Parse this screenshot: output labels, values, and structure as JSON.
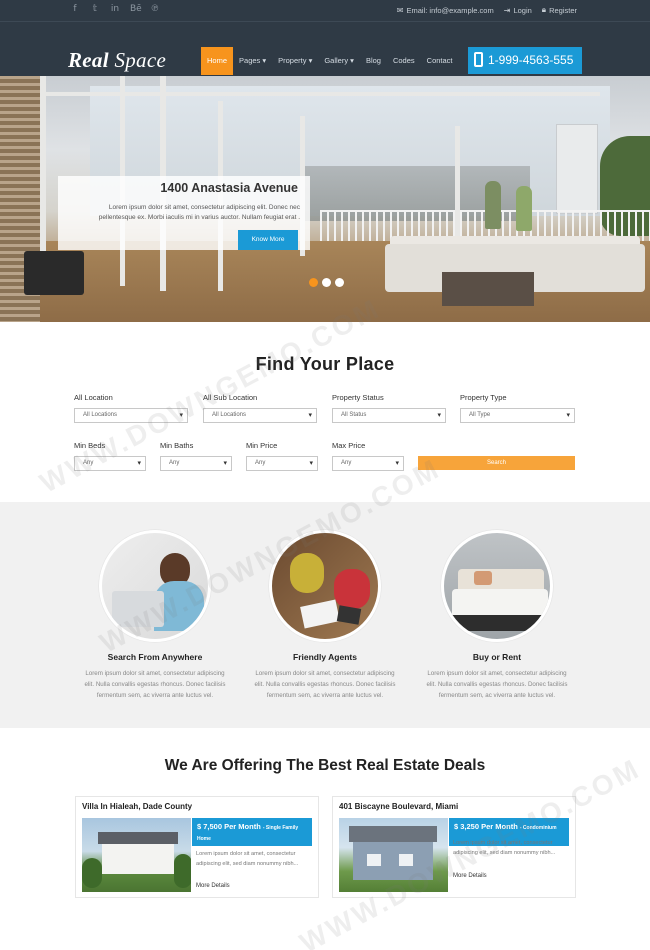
{
  "topbar": {
    "social_icons": [
      "facebook-icon",
      "twitter-icon",
      "linkedin-icon",
      "behance-icon",
      "pinterest-icon"
    ],
    "social_glyphs": [
      "f",
      "𝕥",
      "in",
      "Bē",
      "℗"
    ],
    "email": "Email: info@example.com",
    "login": "Login",
    "register": "Register"
  },
  "header": {
    "logo_bold": "Real",
    "logo_light": "Space",
    "nav": [
      "Home",
      "Pages ▾",
      "Property ▾",
      "Gallery ▾",
      "Blog",
      "Codes",
      "Contact"
    ],
    "phone": "1-999-4563-555"
  },
  "hero": {
    "title": "1400 Anastasia Avenue",
    "text": "Lorem ipsum dolor sit amet, consectetur adipiscing elit. Donec nec pellentesque ex. Morbi iaculis mi in varius auctor. Nullam feugiat erat .",
    "button": "Know More"
  },
  "search": {
    "title": "Find Your Place",
    "labels": {
      "location": "All Location",
      "sub_location": "All Sub Location",
      "status": "Property Status",
      "type": "Property Type",
      "beds": "Min Beds",
      "baths": "Min Baths",
      "min_price": "Min Price",
      "max_price": "Max Price"
    },
    "values": {
      "location": "All Locations",
      "sub_location": "All Locations",
      "status": "All Status",
      "type": "All Type",
      "beds": "Any",
      "baths": "Any",
      "min_price": "Any",
      "max_price": "Any"
    },
    "button": "Search"
  },
  "features": [
    {
      "title": "Search From Anywhere",
      "text": "Lorem ipsum dolor sit amet, consectetur adipiscing elit. Nulla convallis egestas rhoncus. Donec facilisis fermentum sem, ac viverra ante luctus vel."
    },
    {
      "title": "Friendly Agents",
      "text": "Lorem ipsum dolor sit amet, consectetur adipiscing elit. Nulla convallis egestas rhoncus. Donec facilisis fermentum sem, ac viverra ante luctus vel."
    },
    {
      "title": "Buy or Rent",
      "text": "Lorem ipsum dolor sit amet, consectetur adipiscing elit. Nulla convallis egestas rhoncus. Donec facilisis fermentum sem, ac viverra ante luctus vel."
    }
  ],
  "deals": {
    "title": "We Are Offering The Best Real Estate Deals",
    "items": [
      {
        "name": "Villa In Hialeah, Dade County",
        "price": "$ 7,500 Per Month",
        "tag": "- Single Family Home",
        "text": "Lorem ipsum dolor sit amet, consectetur adipiscing elit, sed diam nonummy nibh...",
        "more": "More Details"
      },
      {
        "name": "401 Biscayne Boulevard, Miami",
        "price": "$ 3,250 Per Month",
        "tag": "- Condominium",
        "text": "Lorem ipsum dolor sit amet, consectetur adipiscing elit, sed diam nonummy nibh...",
        "more": "More Details"
      }
    ]
  },
  "watermark": "WWW.DOWNGEMO.COM",
  "colors": {
    "header_bg": "#2f3a45",
    "accent_orange": "#f7941d",
    "accent_blue": "#1b9ad6",
    "features_bg": "#f1f1f1"
  }
}
